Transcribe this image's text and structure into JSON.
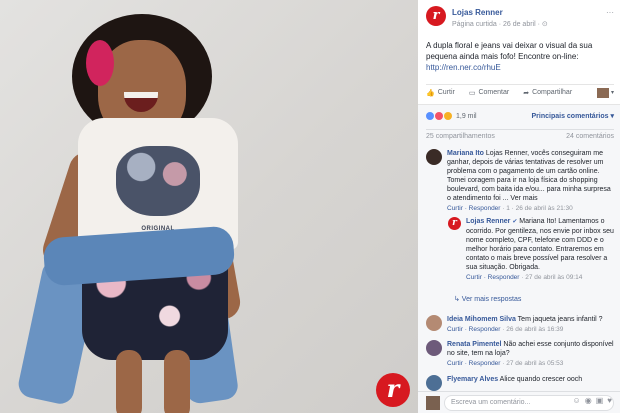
{
  "post": {
    "page_name": "Lojas Renner",
    "meta": "Página curtida · 26 de abril · ⊙",
    "more": "···",
    "text": "A dupla floral e jeans vai deixar o visual da sua pequena ainda mais fofo! Encontre on-line: ",
    "link": "http://ren.ner.co/rhuE",
    "actions": {
      "like": "Curtir",
      "comment": "Comentar",
      "share": "Compartilhar"
    }
  },
  "photo": {
    "shirt_text": "ORIGINAL MICKEY",
    "brand_mark": "r"
  },
  "summary": {
    "reactions_count": "1,9 mil",
    "relevant": "Principais comentários ▾",
    "shares": "25 compartilhamentos",
    "comments_count": "24 comentários"
  },
  "comments": [
    {
      "name": "Mariana Ito",
      "text": " Lojas Renner, vocês conseguiram me ganhar, depois de várias tentativas de resolver um problema com o pagamento de um cartão online. Tomei coragem para ir na loja física do shopping boulevard, com baita ida e/ou... para minha surpresa o atendimento foi ... Ver mais",
      "meta_actions": "Curtir · Responder",
      "meta_likes": " · 1 · 26 de abril às 21:30"
    },
    {
      "name": "Ideia Mihomem Silva",
      "text": " Tem jaqueta jeans infantil ?",
      "meta_actions": "Curtir · Responder",
      "meta_likes": " · 26 de abril às 16:39"
    },
    {
      "name": "Renata Pimentel",
      "text": " Não achei esse conjunto disponível no site, tem na loja?",
      "meta_actions": "Curtir · Responder",
      "meta_likes": " · 27 de abril às 05:53"
    },
    {
      "name": "Flyemary Alves",
      "text": " Alice quando crescer ooch"
    }
  ],
  "reply": {
    "name": "Lojas Renner",
    "verified": "✔",
    "text": " Mariana Ito! Lamentamos o ocorrido. Por gentileza, nos envie por inbox seu nome completo, CPF, telefone com DDD e o melhor horário para contato. Entraremos em contato o mais breve possível para resolver a sua situação. Obrigada.",
    "meta_actions": "Curtir · Responder",
    "meta_likes": " · 27 de abril às 09:14"
  },
  "more_replies": "↳ Ver mais respostas",
  "input": {
    "placeholder": "Escreva um comentário...",
    "icons": [
      "☺",
      "◉",
      "▣",
      "♥"
    ]
  },
  "colors": {
    "brand": "#d71920",
    "link": "#365899",
    "muted": "#90949c"
  }
}
